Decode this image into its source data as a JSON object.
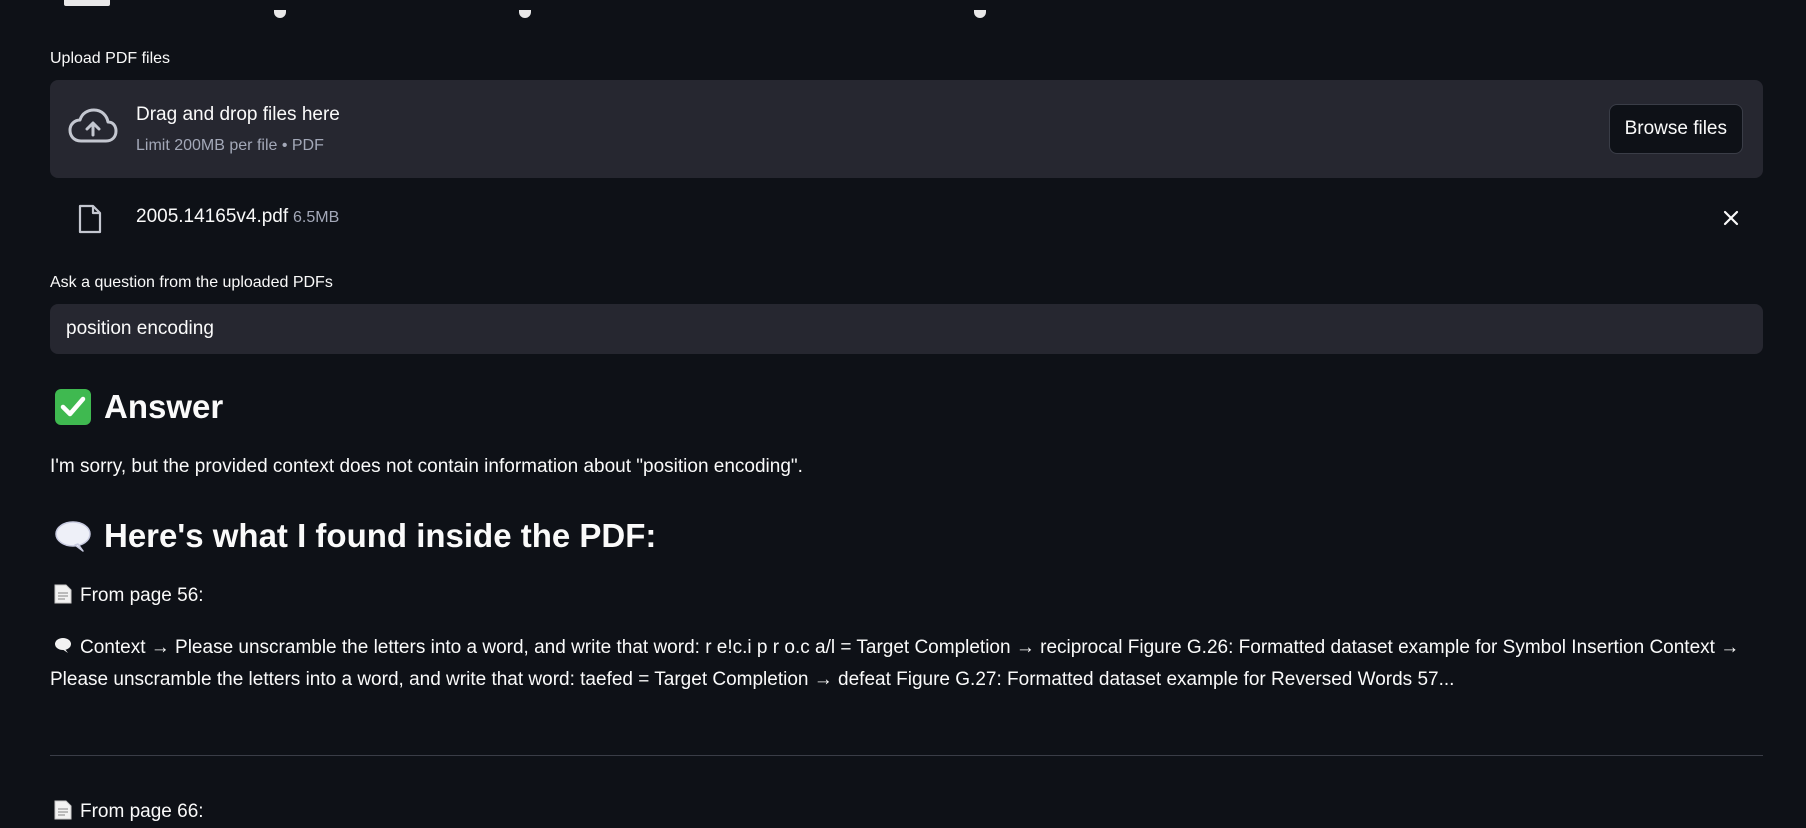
{
  "uploader": {
    "label": "Upload PDF files",
    "drop_title": "Drag and drop files here",
    "drop_subtitle": "Limit 200MB per file • PDF",
    "browse_label": "Browse files"
  },
  "uploaded_file": {
    "name": "2005.14165v4.pdf",
    "size": "6.5MB"
  },
  "question": {
    "label": "Ask a question from the uploaded PDFs",
    "value": "position encoding"
  },
  "answer": {
    "heading": "Answer",
    "heading_icon": "check-mark-button-icon",
    "text": "I'm sorry, but the provided context does not contain information about \"position encoding\"."
  },
  "found": {
    "heading": "Here's what I found inside the PDF:",
    "heading_icon": "speech-balloon-icon",
    "sources": [
      {
        "page_label": "From page 56:",
        "context": "Context → Please unscramble the letters into a word, and write that word: r e!c.i p r o.c a/l = Target Completion → reciprocal Figure G.26: Formatted dataset example for Symbol Insertion Context → Please unscramble the letters into a word, and write that word: taefed = Target Completion → defeat Figure G.27: Formatted dataset example for Reversed Words 57..."
      },
      {
        "page_label": "From page 66:"
      }
    ]
  },
  "colors": {
    "background": "#0e1117",
    "panel": "#262730",
    "text": "#fafafa",
    "muted": "#a3a8b8",
    "check_green": "#3fb950"
  }
}
